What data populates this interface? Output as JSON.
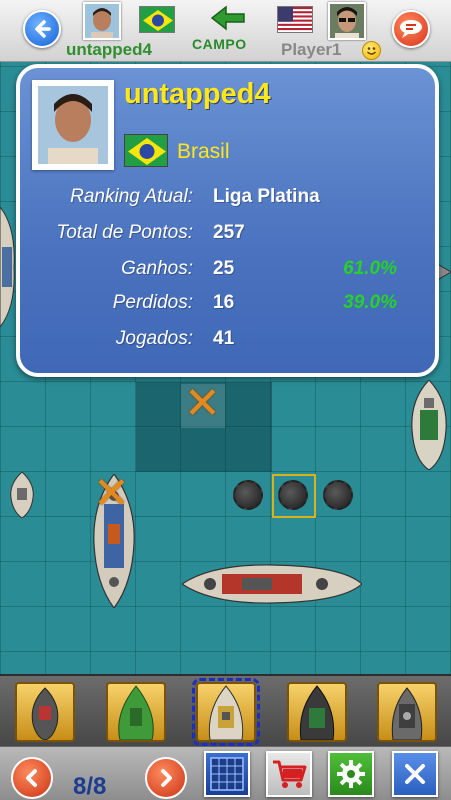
{
  "header": {
    "player_left_name": "untapped4",
    "player_right_name": "Player1",
    "campo_label": "CAMPO",
    "icons": {
      "back": "back-arrow-icon",
      "chat": "chat-bubble-icon",
      "campo": "green-arrow-icon",
      "smiley": "smiley-icon"
    }
  },
  "profile": {
    "name": "untapped4",
    "country": "Brasil",
    "stats": [
      {
        "label": "Ranking Atual:",
        "value": "Liga Platina",
        "pct": ""
      },
      {
        "label": "Total de Pontos:",
        "value": "257",
        "pct": ""
      },
      {
        "label": "Ganhos:",
        "value": "25",
        "pct": "61.0%"
      },
      {
        "label": "Perdidos:",
        "value": "16",
        "pct": "39.0%"
      },
      {
        "label": "Jogados:",
        "value": "41",
        "pct": ""
      }
    ]
  },
  "footer": {
    "page_count": "8/8"
  },
  "colors": {
    "accent_yellow": "#ffe718",
    "win_green": "#25d12a",
    "player_green": "#2f8f2f",
    "panel_blue": "#4a72be"
  }
}
